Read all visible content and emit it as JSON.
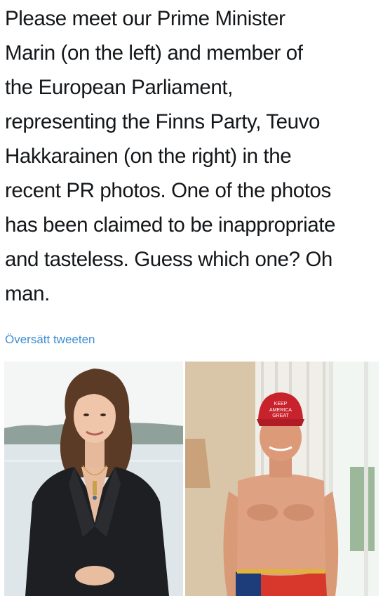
{
  "tweet": {
    "text": "Please meet our Prime Minister\nMarin (on the left) and member of\nthe European Parliament,\nrepresenting the Finns Party, Teuvo\nHakkarainen (on the right) in the\nrecent PR photos. One of the photos\nhas been claimed to be inappropriate\nand tasteless. Guess which one? Oh\nman.",
    "translate_label": "Översätt tweeten"
  },
  "photos": {
    "left": {
      "subject": "woman in dark blazer with pendant necklace, lake background"
    },
    "right": {
      "subject": "shirtless man wearing red cap, standing by window",
      "cap_text_1": "KEEP",
      "cap_text_2": "AMERICA",
      "cap_text_3": "GREAT"
    }
  },
  "colors": {
    "text": "#14171a",
    "link": "#3f8fd2",
    "cap_red": "#c8222c"
  }
}
